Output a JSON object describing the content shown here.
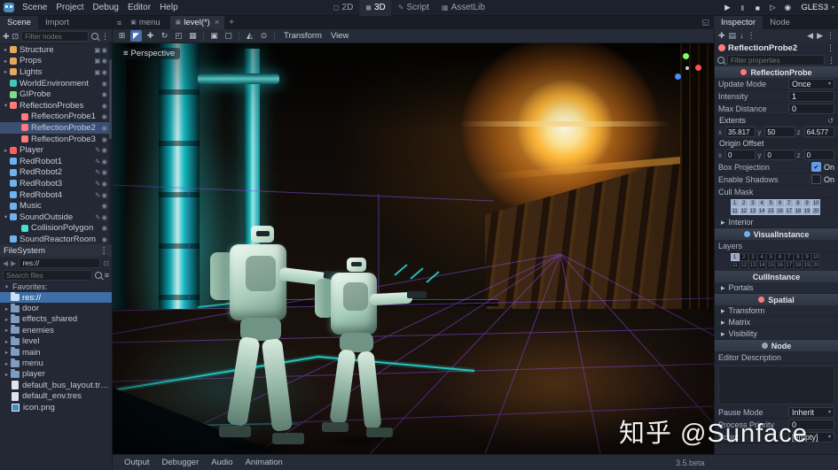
{
  "watermark": "知乎 @Sunface",
  "colors": {
    "accent": "#699ce8",
    "selected_row": "#3a4f72",
    "filesystem_selected": "#3d6ea8",
    "viewport_teal": "#2ee8e0",
    "viewport_orange": "#ffa21e",
    "probe_purple": "#9a4fe8"
  },
  "icons": {
    "kebab": "⋮",
    "back": "◀",
    "forward": "▶",
    "collapse": "▾",
    "expand": "▸",
    "close": "×",
    "add_tab": "+",
    "scene_list": "≡",
    "fullscreen": "◱",
    "tab_scene": "▣",
    "play": "▶",
    "pause": "‖",
    "stop": "■",
    "play_scene": "▷",
    "movie": "◉",
    "dropdown": "▾",
    "add_node": "✚",
    "instance": "⊡",
    "sort": "≡",
    "tool_select": "◤",
    "tool_move": "✚",
    "tool_rotate": "↻",
    "tool_scale": "◰",
    "tool_list": "▦",
    "lock": "▣",
    "unlock": "▢",
    "tool_group": "⊞",
    "tool_local": "◭",
    "tool_snap": "⊙",
    "new_res": "✚",
    "load": "▤",
    "save": "↓",
    "revert": "↺",
    "check": "✔"
  },
  "menubar": {
    "items": [
      {
        "label": "Scene"
      },
      {
        "label": "Project"
      },
      {
        "label": "Debug"
      },
      {
        "label": "Editor"
      },
      {
        "label": "Help"
      }
    ],
    "workspaces": [
      {
        "label": "2D",
        "glyph": "◻"
      },
      {
        "label": "3D",
        "glyph": "◼",
        "active": true
      },
      {
        "label": "Script",
        "glyph": "✎"
      },
      {
        "label": "AssetLib",
        "glyph": "▦"
      }
    ],
    "renderer": "GLES3"
  },
  "editor_tabs": {
    "tabs": [
      {
        "label": "menu",
        "glyph": "▣",
        "close": ""
      },
      {
        "label": "level(*)",
        "glyph": "▣",
        "close": "×",
        "active": true
      }
    ]
  },
  "scene_dock": {
    "tabs": [
      {
        "label": "Scene",
        "active": true
      },
      {
        "label": "Import"
      }
    ],
    "filter_placeholder": "Filter nodes",
    "tree": [
      {
        "label": "Structure",
        "arrow": "▸",
        "color": "orange",
        "trail": "▣◉"
      },
      {
        "label": "Props",
        "arrow": "▸",
        "color": "orange",
        "trail": "▣◉"
      },
      {
        "label": "Lights",
        "arrow": "▸",
        "color": "orange",
        "trail": "▣◉"
      },
      {
        "label": "WorldEnvironment",
        "arrow": "",
        "color": "teal",
        "trail": "◉"
      },
      {
        "label": "GIProbe",
        "arrow": "",
        "color": "green",
        "trail": "◉"
      },
      {
        "label": "ReflectionProbes",
        "arrow": "▾",
        "color": "pink",
        "trail": "◉"
      },
      {
        "label": "ReflectionProbe1",
        "arrow": "",
        "color": "pink",
        "child": true,
        "trail": "◉"
      },
      {
        "label": "ReflectionProbe2",
        "arrow": "",
        "color": "pink",
        "child": true,
        "trail": "◉",
        "selected": true
      },
      {
        "label": "ReflectionProbe3",
        "arrow": "",
        "color": "pink",
        "child": true,
        "trail": "◉"
      },
      {
        "label": "Player",
        "arrow": "▸",
        "color": "red",
        "trail": "✎◉"
      },
      {
        "label": "RedRobot1",
        "arrow": "",
        "color": "blue",
        "trail": "✎◉"
      },
      {
        "label": "RedRobot2",
        "arrow": "",
        "color": "blue",
        "trail": "✎◉"
      },
      {
        "label": "RedRobot3",
        "arrow": "",
        "color": "blue",
        "trail": "✎◉"
      },
      {
        "label": "RedRobot4",
        "arrow": "",
        "color": "blue",
        "trail": "✎◉"
      },
      {
        "label": "Music",
        "arrow": "",
        "color": "blue",
        "trail": "◉"
      },
      {
        "label": "SoundOutside",
        "arrow": "▾",
        "color": "blue",
        "trail": "✎◉"
      },
      {
        "label": "CollisionPolygon",
        "arrow": "",
        "color": "cyan",
        "child": true,
        "trail": "◉"
      },
      {
        "label": "SoundReactorRoom",
        "arrow": "",
        "color": "blue",
        "trail": "◉"
      }
    ]
  },
  "filesystem": {
    "title": "FileSystem",
    "path": "res://",
    "search_placeholder": "Search files",
    "favorites_label": "Favorites:",
    "rows": [
      {
        "label": "res://",
        "type": "root",
        "arrow": "",
        "selected": true
      },
      {
        "label": "door",
        "type": "folder",
        "arrow": "▸"
      },
      {
        "label": "effects_shared",
        "type": "folder",
        "arrow": "▸"
      },
      {
        "label": "enemies",
        "type": "folder",
        "arrow": "▸"
      },
      {
        "label": "level",
        "type": "folder",
        "arrow": "▸"
      },
      {
        "label": "main",
        "type": "folder",
        "arrow": "▸"
      },
      {
        "label": "menu",
        "type": "folder",
        "arrow": "▸"
      },
      {
        "label": "player",
        "type": "folder",
        "arrow": "▸"
      },
      {
        "label": "default_bus_layout.tres",
        "type": "tres",
        "arrow": ""
      },
      {
        "label": "default_env.tres",
        "type": "tres",
        "arrow": ""
      },
      {
        "label": "icon.png",
        "type": "image",
        "arrow": ""
      }
    ]
  },
  "viewport": {
    "perspective_label": "Perspective",
    "menus": [
      {
        "label": "Transform"
      },
      {
        "label": "View"
      }
    ]
  },
  "inspector": {
    "tabs": [
      {
        "label": "Inspector",
        "active": true
      },
      {
        "label": "Node"
      }
    ],
    "node_name": "ReflectionProbe2",
    "filter_placeholder": "Filter properties",
    "categories": {
      "reflectionprobe": "ReflectionProbe",
      "visualinstance": "VisualInstance",
      "cullinstance": "CullInstance",
      "spatial": "Spatial",
      "node": "Node"
    },
    "axis": {
      "x": "x",
      "y": "y",
      "z": "z"
    },
    "rows": {
      "update_mode": {
        "label": "Update Mode",
        "value": "Once"
      },
      "intensity": {
        "label": "Intensity",
        "value": "1"
      },
      "max_distance": {
        "label": "Max Distance",
        "value": "0"
      },
      "extents": {
        "label": "Extents",
        "x": "35.817",
        "y": "50",
        "z": "64.577"
      },
      "origin_offset": {
        "label": "Origin Offset",
        "x": "0",
        "y": "0",
        "z": "0"
      },
      "box_projection": {
        "label": "Box Projection",
        "value": "On"
      },
      "enable_shadows": {
        "label": "Enable Shadows",
        "value": "On"
      },
      "cull_mask": {
        "label": "Cull Mask"
      },
      "interior": {
        "label": "Interior"
      },
      "layers": {
        "label": "Layers"
      },
      "portals": {
        "label": "Portals"
      },
      "transform": {
        "label": "Transform"
      },
      "matrix": {
        "label": "Matrix"
      },
      "visibility": {
        "label": "Visibility"
      },
      "editor_description": {
        "label": "Editor Description"
      },
      "pause_mode": {
        "label": "Pause Mode",
        "value": "Inherit"
      },
      "process_priority": {
        "label": "Process Priority",
        "value": "0"
      },
      "script": {
        "label": "Script",
        "value": "[empty]"
      }
    },
    "cull_cells": [
      {
        "n": "1",
        "on": true
      },
      {
        "n": "2",
        "on": true
      },
      {
        "n": "3",
        "on": true
      },
      {
        "n": "4",
        "on": true
      },
      {
        "n": "5",
        "on": true
      },
      {
        "n": "6",
        "on": true
      },
      {
        "n": "7",
        "on": true
      },
      {
        "n": "8",
        "on": true
      },
      {
        "n": "9",
        "on": true
      },
      {
        "n": "10",
        "on": true
      },
      {
        "n": "11",
        "on": true
      },
      {
        "n": "12",
        "on": true
      },
      {
        "n": "13",
        "on": true
      },
      {
        "n": "14",
        "on": true
      },
      {
        "n": "15",
        "on": true
      },
      {
        "n": "16",
        "on": true
      },
      {
        "n": "17",
        "on": true
      },
      {
        "n": "18",
        "on": true
      },
      {
        "n": "19",
        "on": true
      },
      {
        "n": "20",
        "on": true
      }
    ],
    "layer_cells": [
      {
        "n": "1",
        "on": true
      },
      {
        "n": "2",
        "on": false
      },
      {
        "n": "3",
        "on": false
      },
      {
        "n": "4",
        "on": false
      },
      {
        "n": "5",
        "on": false
      },
      {
        "n": "6",
        "on": false
      },
      {
        "n": "7",
        "on": false
      },
      {
        "n": "8",
        "on": false
      },
      {
        "n": "9",
        "on": false
      },
      {
        "n": "10",
        "on": false
      },
      {
        "n": "11",
        "on": false
      },
      {
        "n": "12",
        "on": false
      },
      {
        "n": "13",
        "on": false
      },
      {
        "n": "14",
        "on": false
      },
      {
        "n": "15",
        "on": false
      },
      {
        "n": "16",
        "on": false
      },
      {
        "n": "17",
        "on": false
      },
      {
        "n": "18",
        "on": false
      },
      {
        "n": "19",
        "on": false
      },
      {
        "n": "20",
        "on": false
      }
    ]
  },
  "bottom_bar": {
    "items": [
      {
        "label": "Output"
      },
      {
        "label": "Debugger"
      },
      {
        "label": "Audio"
      },
      {
        "label": "Animation"
      }
    ],
    "version": "3.5.beta"
  }
}
